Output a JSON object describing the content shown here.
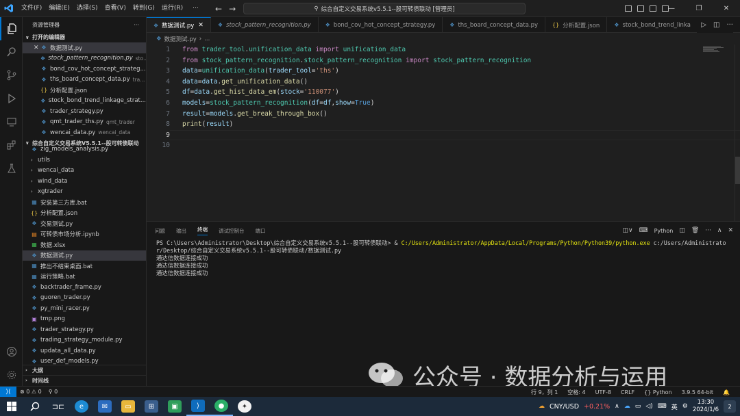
{
  "titlebar": {
    "menu": [
      "文件(F)",
      "编辑(E)",
      "选择(S)",
      "查看(V)",
      "转到(G)",
      "运行(R)"
    ],
    "more": "···",
    "search_text": "综合自定义交易系统v5.5.1--股可转债联动 [管理员]"
  },
  "sidebar": {
    "title": "资源管理器",
    "open_editors_label": "打开的编辑器",
    "open_editors": [
      {
        "name": "数据测试.py",
        "desc": "",
        "type": "py",
        "italic": false
      },
      {
        "name": "stock_pattern_recognition.py",
        "desc": "sto...",
        "type": "py",
        "italic": true
      },
      {
        "name": "bond_cov_hot_concept_strateg...",
        "desc": "",
        "type": "py",
        "italic": false
      },
      {
        "name": "ths_board_concept_data.py",
        "desc": "tra...",
        "type": "py",
        "italic": false
      },
      {
        "name": "分析配置.json",
        "desc": "",
        "type": "json",
        "italic": false
      },
      {
        "name": "stock_bond_trend_linkage_strat...",
        "desc": "",
        "type": "py",
        "italic": false
      },
      {
        "name": "trader_strategy.py",
        "desc": "",
        "type": "py",
        "italic": false
      },
      {
        "name": "qmt_trader_ths.py",
        "desc": "qmt_trader",
        "type": "py",
        "italic": false
      },
      {
        "name": "wencai_data.py",
        "desc": "wencai_data",
        "type": "py",
        "italic": false
      }
    ],
    "project_label": "综合自定义交易系统V5.5.1--股可转债联动",
    "tree": [
      {
        "name": "zig_models_analysis.py",
        "kind": "file",
        "type": "py"
      },
      {
        "name": "utils",
        "kind": "folder"
      },
      {
        "name": "wencai_data",
        "kind": "folder"
      },
      {
        "name": "wind_data",
        "kind": "folder"
      },
      {
        "name": "xgtrader",
        "kind": "folder"
      },
      {
        "name": "安装第三方库.bat",
        "kind": "file",
        "type": "bat"
      },
      {
        "name": "分析配置.json",
        "kind": "file",
        "type": "json"
      },
      {
        "name": "交易测试.py",
        "kind": "file",
        "type": "py"
      },
      {
        "name": "可转债市场分析.ipynb",
        "kind": "file",
        "type": "nb"
      },
      {
        "name": "数据.xlsx",
        "kind": "file",
        "type": "xls"
      },
      {
        "name": "数据测试.py",
        "kind": "file",
        "type": "py",
        "selected": true
      },
      {
        "name": "推出不结束桌面.bat",
        "kind": "file",
        "type": "bat"
      },
      {
        "name": "运行策略.bat",
        "kind": "file",
        "type": "bat"
      },
      {
        "name": "backtrader_frame.py",
        "kind": "file",
        "type": "py"
      },
      {
        "name": "guoren_trader.py",
        "kind": "file",
        "type": "py"
      },
      {
        "name": "py_mini_racer.py",
        "kind": "file",
        "type": "py"
      },
      {
        "name": "tmp.png",
        "kind": "file",
        "type": "img"
      },
      {
        "name": "trader_strategy.py",
        "kind": "file",
        "type": "py"
      },
      {
        "name": "trading_strategy_module.py",
        "kind": "file",
        "type": "py"
      },
      {
        "name": "updata_all_data.py",
        "kind": "file",
        "type": "py"
      },
      {
        "name": "user_def_models.py",
        "kind": "file",
        "type": "py"
      }
    ],
    "outline_label": "大纲",
    "timeline_label": "时间线"
  },
  "tabs": [
    {
      "label": "数据测试.py",
      "active": true,
      "icon": "py"
    },
    {
      "label": "stock_pattern_recognition.py",
      "active": false,
      "icon": "py",
      "italic": true
    },
    {
      "label": "bond_cov_hot_concept_strategy.py",
      "active": false,
      "icon": "py"
    },
    {
      "label": "ths_board_concept_data.py",
      "active": false,
      "icon": "py"
    },
    {
      "label": "分析配置.json",
      "active": false,
      "icon": "json"
    },
    {
      "label": "stock_bond_trend_linka",
      "active": false,
      "icon": "py"
    }
  ],
  "breadcrumb": {
    "file": "数据测试.py",
    "rest": "..."
  },
  "code": {
    "line_numbers": [
      "1",
      "2",
      "3",
      "4",
      "5",
      "6",
      "7",
      "8",
      "9",
      "10"
    ]
  },
  "panel": {
    "tabs": [
      "问题",
      "输出",
      "终端",
      "调试控制台",
      "端口"
    ],
    "active_tab": "终端",
    "python_label": "Python",
    "prompt_prefix": "PS C:\\Users\\Administrator\\Desktop\\综合自定义交易系统v5.5.1--股可转债联动> & ",
    "python_path": "C:/Users/Administrator/AppData/Local/Programs/Python/Python39/python.exe",
    "script_path": " c:/Users/Administrator/Desktop/综合自定义交易系统v5.5.1--股可转债联动/数据测试.py",
    "output": [
      "通达信数据连接成功",
      "通达信数据连接成功",
      "通达信数据连接成功"
    ]
  },
  "statusbar": {
    "problems": "⊗ 0 ⚠ 0",
    "ports": "⚲ 0",
    "position": "行 9，列 1",
    "spaces": "空格: 4",
    "encoding": "UTF-8",
    "eol": "CRLF",
    "language": "Python",
    "interpreter": "3.9.5 64-bit"
  },
  "taskbar": {
    "stock_name": "CNY/USD",
    "stock_change": "+0.21%",
    "ime": "英",
    "time": "13:30",
    "date": "2024/1/6",
    "notification_count": "2"
  },
  "watermark": {
    "text": "公众号 · 数据分析与运用"
  }
}
